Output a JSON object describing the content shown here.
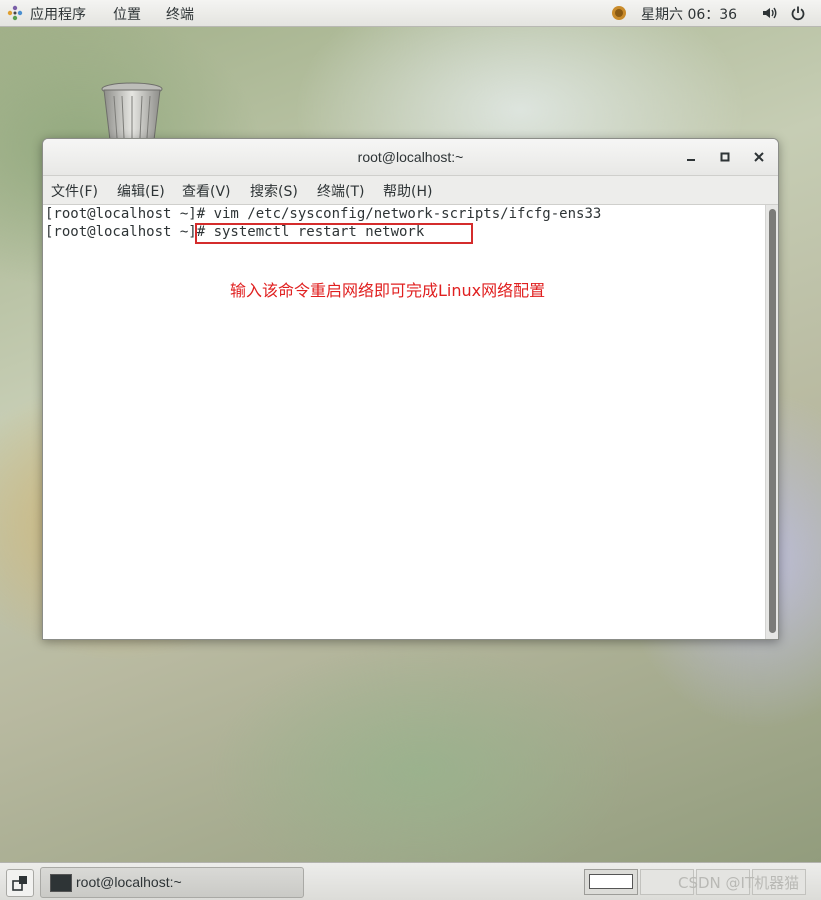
{
  "topbar": {
    "applications": "应用程序",
    "places": "位置",
    "terminal": "终端",
    "clock": "星期六 06：36"
  },
  "window": {
    "title": "root@localhost:~",
    "menu": [
      "文件(F)",
      "编辑(E)",
      "查看(V)",
      "搜索(S)",
      "终端(T)",
      "帮助(H)"
    ]
  },
  "terminal": {
    "lines": [
      "[root@localhost ~]# vim /etc/sysconfig/network-scripts/ifcfg-ens33",
      "[root@localhost ~]# systemctl restart network"
    ]
  },
  "annotation": "输入该命令重启网络即可完成Linux网络配置",
  "taskbar": {
    "task_label": "root@localhost:~",
    "watermark": "CSDN @IT机器猫"
  },
  "colors": {
    "annotation_red": "#e02020",
    "box_red": "#d42c2c"
  }
}
